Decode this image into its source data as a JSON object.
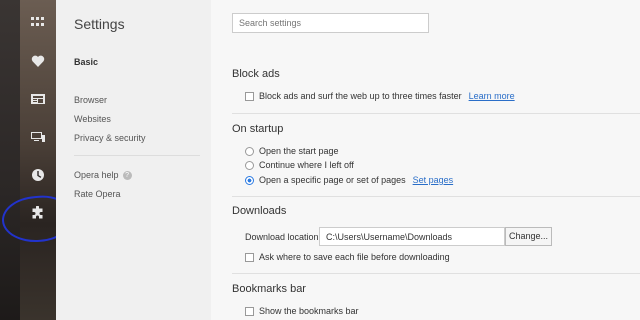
{
  "sidebar_strip": {
    "icons": [
      "speed-dial-icon",
      "heart-icon",
      "news-icon",
      "devices-icon",
      "history-icon",
      "extensions-icon"
    ]
  },
  "nav": {
    "title": "Settings",
    "items": [
      {
        "label": "Basic"
      },
      {
        "label": "Browser"
      },
      {
        "label": "Websites"
      },
      {
        "label": "Privacy & security"
      }
    ],
    "help": {
      "label": "Opera help"
    },
    "rate": {
      "label": "Rate Opera"
    }
  },
  "search": {
    "placeholder": "Search settings"
  },
  "block_ads": {
    "title": "Block ads",
    "option": "Block ads and surf the web up to three times faster",
    "link": "Learn more"
  },
  "startup": {
    "title": "On startup",
    "options": [
      {
        "label": "Open the start page",
        "selected": false
      },
      {
        "label": "Continue where I left off",
        "selected": false
      },
      {
        "label": "Open a specific page or set of pages",
        "selected": true
      }
    ],
    "link": "Set pages"
  },
  "downloads": {
    "title": "Downloads",
    "location_label": "Download location:",
    "location_value": "C:\\Users\\Username\\Downloads",
    "change_button": "Change...",
    "ask_option": "Ask where to save each file before downloading"
  },
  "bookmarks": {
    "title": "Bookmarks bar",
    "option": "Show the bookmarks bar"
  },
  "colors": {
    "accent": "#2a7ae2",
    "link": "#2a6ec8",
    "annotation": "#2233cc"
  }
}
